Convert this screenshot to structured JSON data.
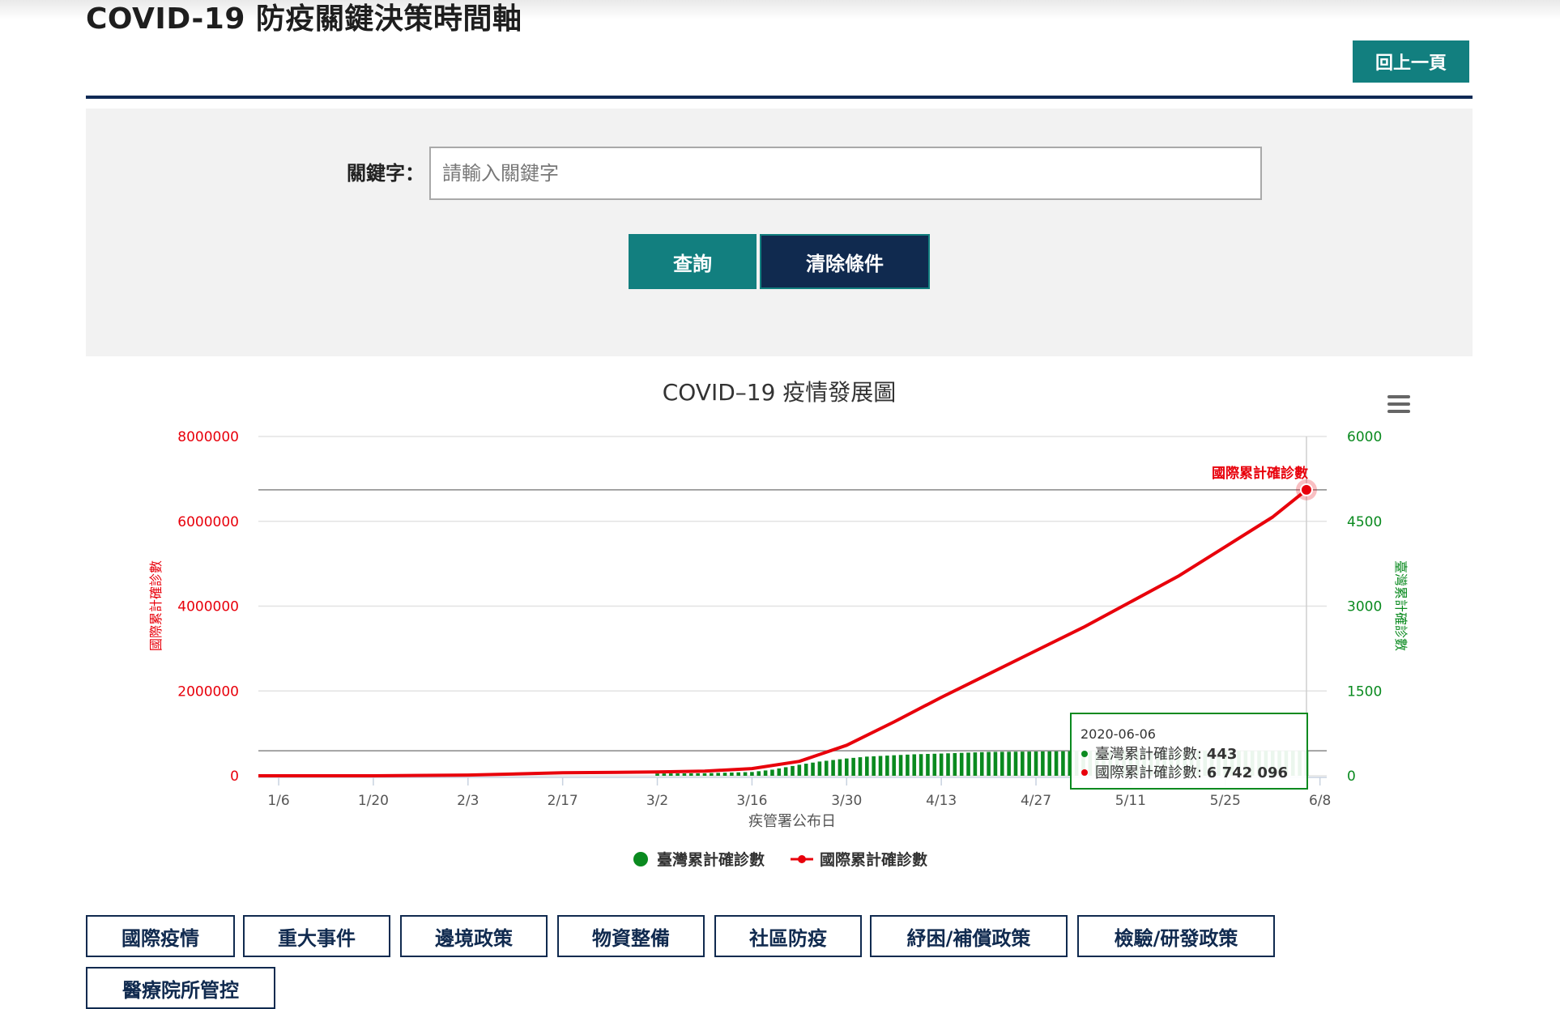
{
  "header": {
    "title": "COVID-19 防疫關鍵決策時間軸",
    "back_label": "回上一頁"
  },
  "search": {
    "label": "關鍵字：",
    "placeholder": "請輸入關鍵字",
    "value": "",
    "query_label": "查詢",
    "clear_label": "清除條件"
  },
  "colors": {
    "teal": "#127f7f",
    "navy": "#102a4f",
    "intl": "#e8000b",
    "taiwan": "#0a8a1f"
  },
  "menu_icon": "hamburger-menu-icon",
  "chart_data": {
    "type": "line",
    "title": "COVID–19 疫情發展圖",
    "xlabel": "疾管署公布日",
    "y_left_label": "國際累計確診數",
    "y_right_label": "臺灣累計確診數",
    "x_ticks": [
      "1/6",
      "1/20",
      "2/3",
      "2/17",
      "3/2",
      "3/16",
      "3/30",
      "4/13",
      "4/27",
      "5/11",
      "5/25",
      "6/8"
    ],
    "y_left_ticks": [
      "0",
      "2000000",
      "4000000",
      "6000000",
      "8000000"
    ],
    "y_right_ticks": [
      "0",
      "1500",
      "3000",
      "4500",
      "6000"
    ],
    "y_left_range": [
      0,
      8000000
    ],
    "y_right_range": [
      0,
      6000
    ],
    "x_range": [
      "2020-01-03",
      "2020-06-09"
    ],
    "grid": true,
    "legend_position": "bottom",
    "series": [
      {
        "name": "國際累計確診數",
        "axis": "left",
        "style": "line",
        "points": [
          [
            "2020-01-03",
            50
          ],
          [
            "2020-01-20",
            300
          ],
          [
            "2020-02-03",
            17000
          ],
          [
            "2020-02-17",
            71000
          ],
          [
            "2020-03-02",
            89000
          ],
          [
            "2020-03-09",
            110000
          ],
          [
            "2020-03-16",
            170000
          ],
          [
            "2020-03-23",
            340000
          ],
          [
            "2020-03-30",
            720000
          ],
          [
            "2020-04-06",
            1270000
          ],
          [
            "2020-04-13",
            1850000
          ],
          [
            "2020-04-20",
            2400000
          ],
          [
            "2020-04-27",
            2950000
          ],
          [
            "2020-05-04",
            3500000
          ],
          [
            "2020-05-11",
            4100000
          ],
          [
            "2020-05-18",
            4700000
          ],
          [
            "2020-05-25",
            5400000
          ],
          [
            "2020-06-01",
            6100000
          ],
          [
            "2020-06-06",
            6742096
          ]
        ]
      },
      {
        "name": "臺灣累計確診數",
        "axis": "right",
        "style": "column",
        "points": [
          [
            "2020-03-02",
            40
          ],
          [
            "2020-03-09",
            45
          ],
          [
            "2020-03-16",
            67
          ],
          [
            "2020-03-19",
            108
          ],
          [
            "2020-03-23",
            195
          ],
          [
            "2020-03-26",
            252
          ],
          [
            "2020-03-30",
            306
          ],
          [
            "2020-04-02",
            339
          ],
          [
            "2020-04-06",
            363
          ],
          [
            "2020-04-09",
            380
          ],
          [
            "2020-04-13",
            393
          ],
          [
            "2020-04-20",
            422
          ],
          [
            "2020-04-27",
            429
          ],
          [
            "2020-05-04",
            438
          ],
          [
            "2020-05-11",
            440
          ],
          [
            "2020-05-25",
            441
          ],
          [
            "2020-06-06",
            443
          ]
        ]
      }
    ],
    "end_label": "國際累計確診數",
    "tooltip": {
      "date": "2020-06-06",
      "taiwan_label": "臺灣累計確診數: ",
      "taiwan_value": "443",
      "intl_label": "國際累計確診數: ",
      "intl_value": "6 742 096"
    },
    "legend": [
      "臺灣累計確診數",
      "國際累計確診數"
    ]
  },
  "categories": [
    "國際疫情",
    "重大事件",
    "邊境政策",
    "物資整備",
    "社區防疫",
    "紓困/補償政策",
    "檢驗/研發政策",
    "醫療院所管控"
  ]
}
